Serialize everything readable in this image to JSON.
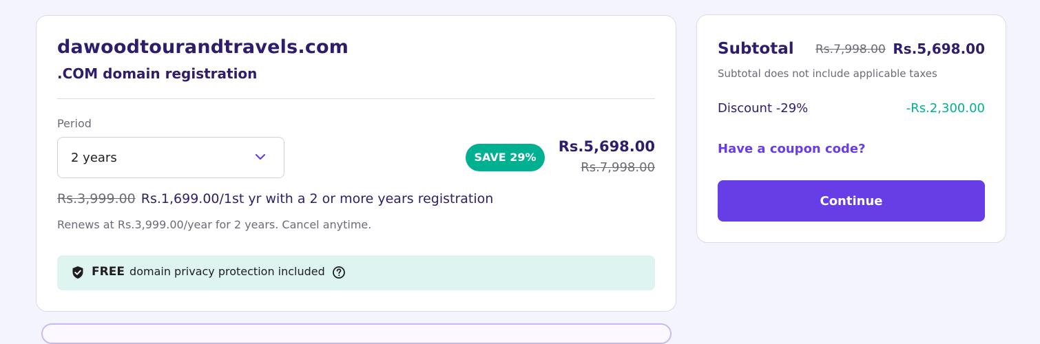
{
  "product": {
    "domain_name": "dawoodtourandtravels.com",
    "type_label": ".COM domain registration"
  },
  "period": {
    "label": "Period",
    "selected_value": "2 years"
  },
  "pricing": {
    "save_badge": "SAVE 29%",
    "current_price": "Rs.5,698.00",
    "original_price": "Rs.7,998.00",
    "promo_old_price": "Rs.3,999.00",
    "promo_text": "Rs.1,699.00/1st yr with a 2 or more years registration",
    "renew_note": "Renews at Rs.3,999.00/year for 2 years. Cancel anytime."
  },
  "privacy": {
    "free_label": "FREE",
    "text": "domain privacy protection included"
  },
  "summary": {
    "subtotal_label": "Subtotal",
    "subtotal_old": "Rs.7,998.00",
    "subtotal_new": "Rs.5,698.00",
    "subtotal_note": "Subtotal does not include applicable taxes",
    "discount_label": "Discount -29%",
    "discount_value": "-Rs.2,300.00",
    "coupon_link": "Have a coupon code?",
    "continue_label": "Continue"
  },
  "icons": {
    "dropdown": "chevron-down-icon",
    "privacy": "shield-check-icon",
    "help": "question-circle-icon"
  },
  "colors": {
    "brand_primary": "#673de6",
    "heading": "#2f1c6a",
    "success": "#00b090",
    "privacy_bg": "#def4f0",
    "page_bg": "#f4f4ff"
  }
}
